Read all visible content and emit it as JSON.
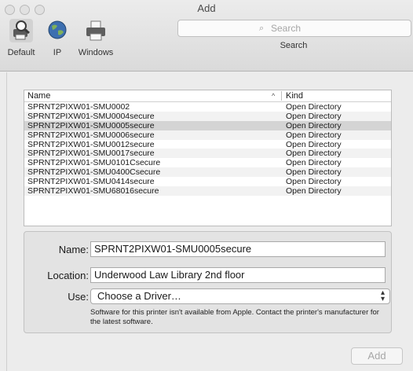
{
  "window": {
    "title": "Add"
  },
  "toolbar": {
    "items": [
      {
        "label": "Default",
        "icon": "printer-magnifier-icon",
        "selected": true
      },
      {
        "label": "IP",
        "icon": "globe-icon",
        "selected": false
      },
      {
        "label": "Windows",
        "icon": "printer-icon",
        "selected": false
      }
    ],
    "search": {
      "placeholder": "Search",
      "label": "Search"
    }
  },
  "list": {
    "columns": {
      "name": "Name",
      "kind": "Kind",
      "sort_indicator": "^"
    },
    "rows": [
      {
        "name": "SPRNT2PIXW01-SMU0002",
        "kind": "Open Directory",
        "selected": false
      },
      {
        "name": "SPRNT2PIXW01-SMU0004secure",
        "kind": "Open Directory",
        "selected": false
      },
      {
        "name": "SPRNT2PIXW01-SMU0005secure",
        "kind": "Open Directory",
        "selected": true
      },
      {
        "name": "SPRNT2PIXW01-SMU0006secure",
        "kind": "Open Directory",
        "selected": false
      },
      {
        "name": "SPRNT2PIXW01-SMU0012secure",
        "kind": "Open Directory",
        "selected": false
      },
      {
        "name": "SPRNT2PIXW01-SMU0017secure",
        "kind": "Open Directory",
        "selected": false
      },
      {
        "name": "SPRNT2PIXW01-SMU0101Csecure",
        "kind": "Open Directory",
        "selected": false
      },
      {
        "name": "SPRNT2PIXW01-SMU0400Csecure",
        "kind": "Open Directory",
        "selected": false
      },
      {
        "name": "SPRNT2PIXW01-SMU0414secure",
        "kind": "Open Directory",
        "selected": false
      },
      {
        "name": "SPRNT2PIXW01-SMU68016secure",
        "kind": "Open Directory",
        "selected": false
      }
    ]
  },
  "details": {
    "name_label": "Name:",
    "name_value": "SPRNT2PIXW01-SMU0005secure",
    "location_label": "Location:",
    "location_value": "Underwood Law Library 2nd floor",
    "use_label": "Use:",
    "use_value": "Choose a Driver…",
    "note": "Software for this printer isn't available from Apple. Contact the printer's manufacturer for the latest software."
  },
  "add_button": {
    "label": "Add",
    "enabled": false
  }
}
